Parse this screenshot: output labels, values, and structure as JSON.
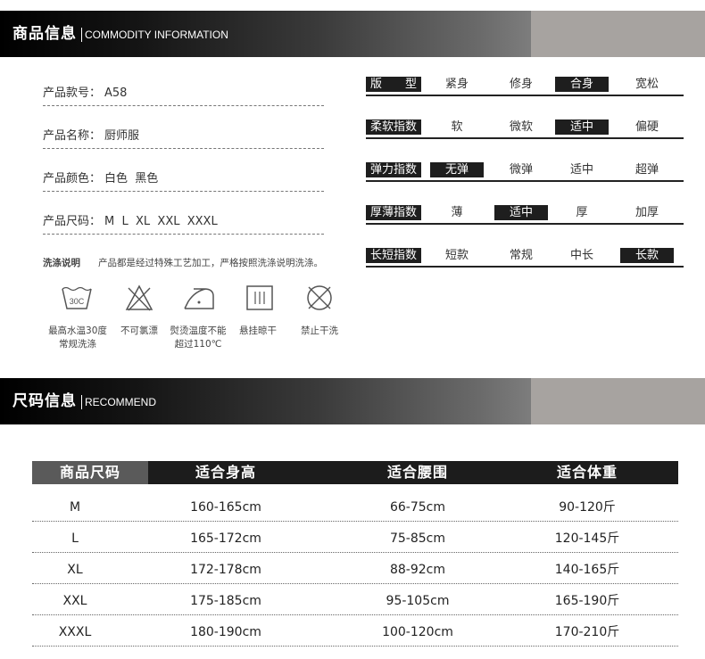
{
  "commodity_header": {
    "title": "商品信息",
    "subtitle": "COMMODITY INFORMATION"
  },
  "info_fields": [
    {
      "label": "产品款号：",
      "value": "A58"
    },
    {
      "label": "产品名称：",
      "value": "厨师服"
    },
    {
      "label": "产品颜色：",
      "value": "白色  黑色"
    },
    {
      "label": "产品尺码：",
      "value": "M  L  XL  XXL  XXXL"
    }
  ],
  "wash": {
    "title": "洗涤说明",
    "note": "产品都是经过特殊工艺加工，严格按照洗涤说明洗涤。",
    "icons": [
      {
        "icon": "wash-30-icon",
        "icon_text": "30C",
        "caption1": "最高水温30度",
        "caption2": "常规洗涤"
      },
      {
        "icon": "no-bleach-icon",
        "caption1": "不可氯漂",
        "caption2": ""
      },
      {
        "icon": "iron-icon",
        "caption1": "熨烫温度不能",
        "caption2": "超过110℃"
      },
      {
        "icon": "hang-dry-icon",
        "caption1": "悬挂晾干",
        "caption2": ""
      },
      {
        "icon": "no-dry-clean-icon",
        "caption1": "禁止干洗",
        "caption2": ""
      }
    ]
  },
  "params": [
    {
      "name": "版　　型",
      "options": [
        "紧身",
        "修身",
        "合身",
        "宽松"
      ],
      "selected": 2
    },
    {
      "name": "柔软指数",
      "options": [
        "软",
        "微软",
        "适中",
        "偏硬"
      ],
      "selected": 2
    },
    {
      "name": "弹力指数",
      "options": [
        "无弹",
        "微弹",
        "适中",
        "超弹"
      ],
      "selected": 0
    },
    {
      "name": "厚薄指数",
      "options": [
        "薄",
        "适中",
        "厚",
        "加厚"
      ],
      "selected": 1
    },
    {
      "name": "长短指数",
      "options": [
        "短款",
        "常规",
        "中长",
        "长款"
      ],
      "selected": 3
    }
  ],
  "size_header": {
    "title": "尺码信息",
    "subtitle": "RECOMMEND"
  },
  "size_table": {
    "headers": [
      "商品尺码",
      "适合身高",
      "适合腰围",
      "适合体重"
    ],
    "rows": [
      [
        "M",
        "160-165cm",
        "66-75cm",
        "90-120斤"
      ],
      [
        "L",
        "165-172cm",
        "75-85cm",
        "120-145斤"
      ],
      [
        "XL",
        "172-178cm",
        "88-92cm",
        "140-165斤"
      ],
      [
        "XXL",
        "175-185cm",
        "95-105cm",
        "165-190斤"
      ],
      [
        "XXXL",
        "180-190cm",
        "100-120cm",
        "170-210斤"
      ]
    ]
  },
  "colors": {
    "dark": "#1e1e1e",
    "header_gray": "#a7a3a0"
  }
}
